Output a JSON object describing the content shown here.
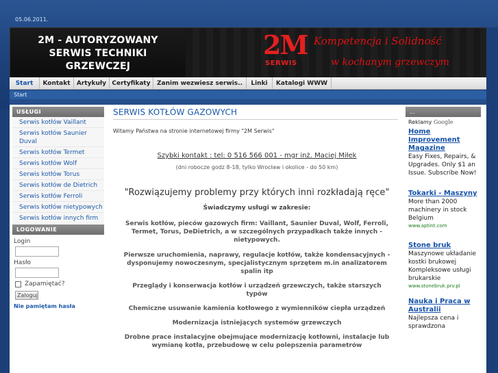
{
  "date": "05.06.2011.",
  "header": {
    "title_lines": [
      "2M - AUTORYZOWANY",
      "SERWIS TECHNIKI",
      "GRZEWCZEJ"
    ],
    "logo_text": "2M",
    "logo_sub": "SERWIS",
    "slogan1": "Kompetencja i Solidność",
    "slogan2": "w kochanym grzewczym"
  },
  "nav": [
    "Start",
    "Kontakt",
    "Artykuły",
    "Certyfikaty",
    "Zanim wezwiesz serwis..",
    "Linki",
    "Katalogi WWW"
  ],
  "breadcrumb": "Start",
  "sidebar": {
    "services_title": "USŁUGI",
    "services": [
      "Serwis kotłów Vaillant",
      "Serwis kotłów Saunier Duval",
      "Serwis kotłów Termet",
      "Serwis kotłów Wolf",
      "Serwis kotłów Torus",
      "Serwis kotłów de Dietrich",
      "Serwis kotłów Ferroli",
      "Serwis kotłów nietypowych",
      "Serwis kotłów innych firm"
    ],
    "login_title": "LOGOWANIE",
    "login_label": "Login",
    "password_label": "Hasło",
    "remember_label": "Zapamiętać?",
    "login_button": "Zaloguj",
    "forgot": "Nie pamiętam hasła"
  },
  "content": {
    "title": "SERWIS KOTŁÓW GAZOWYCH",
    "welcome": "Witamy Państwa na stronie internetowej firmy \"2M Serwis\"",
    "contact": "Szybki kontakt : tel: 0 516 566 001 - mgr inż. Maciej Miłek",
    "hours": "(dni robocze godz 8-18, tylko Wrocław i okolice - do 50 km)",
    "quote": "\"Rozwiązujemy problemy przy których inni rozkładają ręce\"",
    "services_intro": "Świadczymy usługi w zakresie:",
    "s1": "Serwis kotłów, pieców gazowych firm: Vaillant, Saunier Duval, Wolf, Ferroli, Termet, Torus, DeDietrich, a w szczególnych przypadkach także innych - nietypowych.",
    "s2": "Pierwsze uruchomienia, naprawy, regulacje kotłów, także kondensacyjnych - dysponujemy nowoczesnym, specjalistycznym sprzętem m.in analizatorem spalin itp",
    "s3": "Przeglądy i konserwacja kotłów i urządzeń grzewczych, także starszych typów",
    "s4": "Chemiczne usuwanie kamienia kotłowego z wymienników ciepła urządzeń",
    "s5": "Modernizacja istniejących systemów grzewczych",
    "s6": "Drobne prace instalacyjne obejmujące modernizację kotłowni, instalacje lub wymianę kotła, przebudowę w celu polepszenia parametrów"
  },
  "right": {
    "head": "...",
    "ads_label": "Reklamy",
    "ads_brand": "Google",
    "ads": [
      {
        "title": "Home Improvement Magazine",
        "text": "Easy Fixes, Repairs, & Upgrades. Only $1 an Issue. Subscribe Now!",
        "url": ""
      },
      {
        "title": "Tokarki - Maszyny",
        "text": "More than 2000 machinery in stock Belgium",
        "url": "www.aptint.com"
      },
      {
        "title": "Stone bruk",
        "text": "Maszynowe układanie kostki brukowej Kompleksowe usługi brukarskie",
        "url": "www.stonebruk.prv.pl"
      },
      {
        "title": "Nauka i Praca w Australii",
        "text": "Najlepsza cena i sprawdzona",
        "url": ""
      }
    ]
  }
}
